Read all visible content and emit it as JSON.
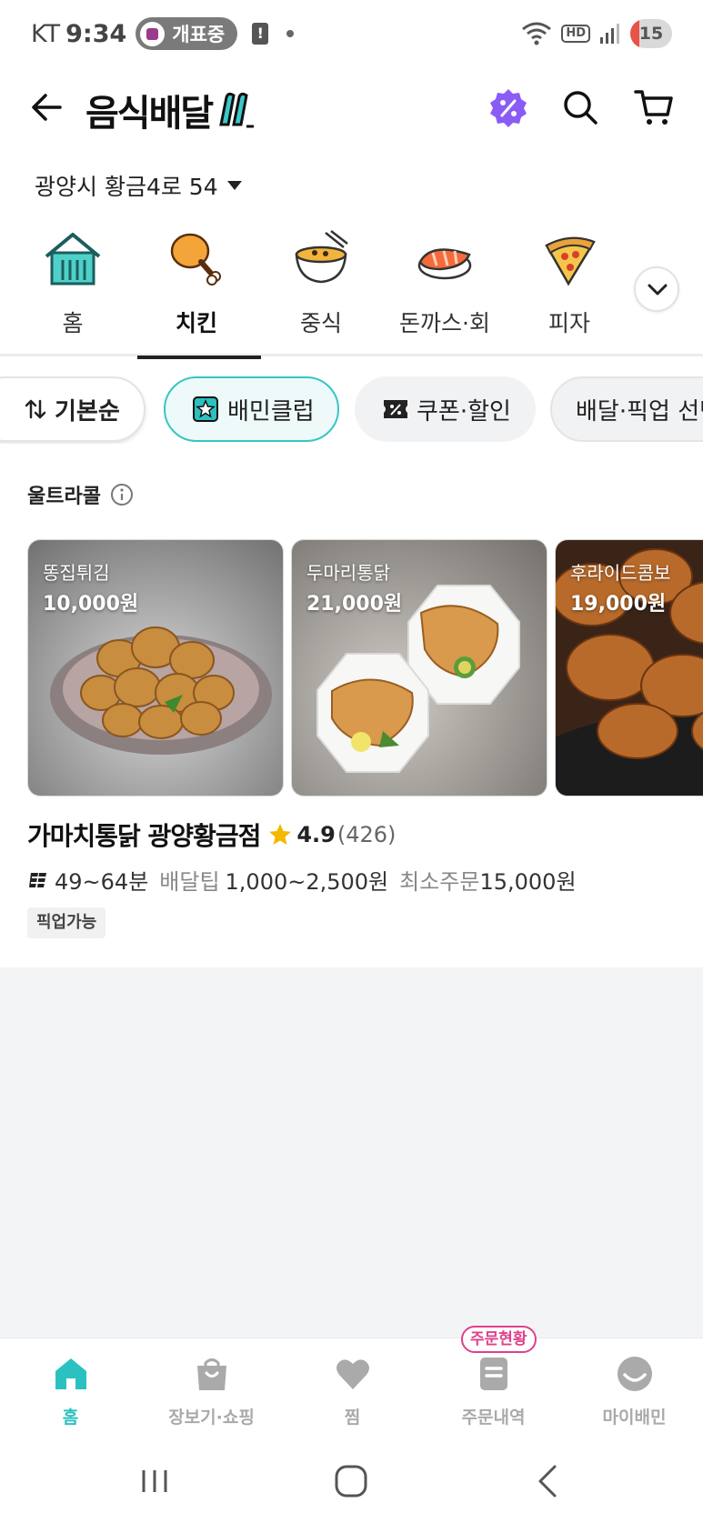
{
  "status_bar": {
    "carrier": "KT",
    "time": "9:34",
    "pill_text": "개표중",
    "battery": "15"
  },
  "header": {
    "title": "음식배달"
  },
  "address": {
    "text": "광양시 황금4로 54"
  },
  "categories": [
    {
      "label": "홈",
      "icon": "home-icon",
      "active": false
    },
    {
      "label": "치킨",
      "icon": "chicken-icon",
      "active": true
    },
    {
      "label": "중식",
      "icon": "noodle-icon",
      "active": false
    },
    {
      "label": "돈까스·회",
      "icon": "sushi-icon",
      "active": false
    },
    {
      "label": "피자",
      "icon": "pizza-icon",
      "active": false
    }
  ],
  "filters": {
    "sort": "기본순",
    "club": "배민클럽",
    "coupon": "쿠폰·할인",
    "delivery": "배달·픽업 선택"
  },
  "section": {
    "title": "울트라콜"
  },
  "menu_items": [
    {
      "name": "똥집튀김",
      "price": "10,000원"
    },
    {
      "name": "두마리통닭",
      "price": "21,000원"
    },
    {
      "name": "후라이드콤보",
      "price": "19,000원"
    }
  ],
  "store": {
    "name": "가마치통닭 광양황금점",
    "rating": "4.9",
    "reviews": "(426)",
    "delivery_time": "49~64분",
    "tip_label": "배달팁",
    "tip_value": "1,000~2,500원",
    "min_label": "최소주문",
    "min_value": "15,000원",
    "badge": "픽업가능"
  },
  "bottom_nav": {
    "items": [
      {
        "label": "홈",
        "active": true
      },
      {
        "label": "장보기·쇼핑",
        "active": false
      },
      {
        "label": "찜",
        "active": false
      },
      {
        "label": "주문내역",
        "active": false
      },
      {
        "label": "마이배민",
        "active": false
      }
    ],
    "order_status": "주문현황"
  },
  "colors": {
    "accent": "#2cc1c1",
    "coupon_purple": "#8a5cf6",
    "order_pink": "#e0408a",
    "star": "#f5b800"
  }
}
